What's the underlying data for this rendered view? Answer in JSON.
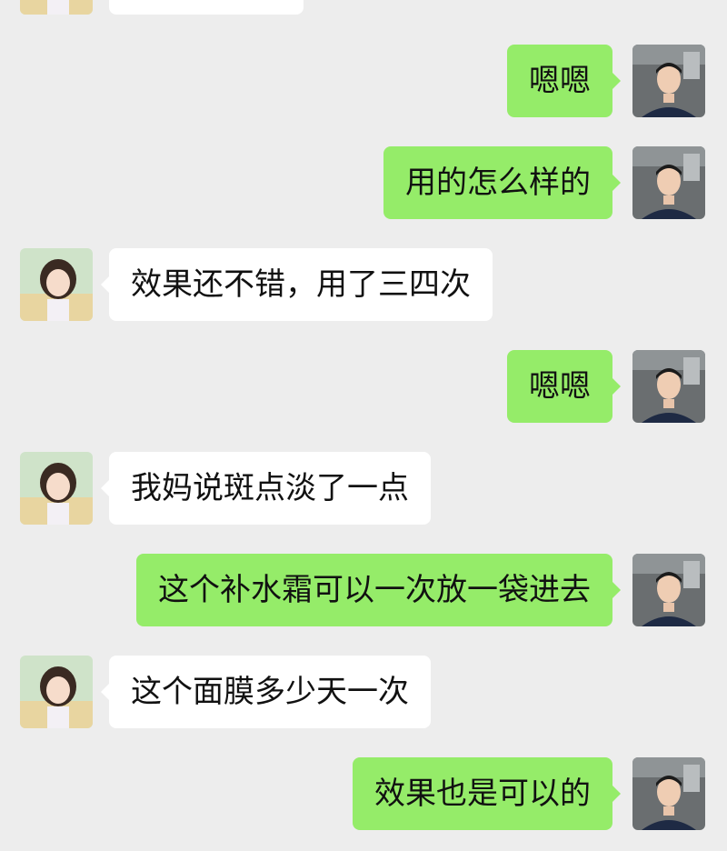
{
  "conversation": {
    "messages": [
      {
        "side": "left",
        "text": "",
        "avatar": "female-contact-avatar"
      },
      {
        "side": "right",
        "text": "嗯嗯",
        "avatar": "male-user-avatar"
      },
      {
        "side": "right",
        "text": "用的怎么样的",
        "avatar": "male-user-avatar"
      },
      {
        "side": "left",
        "text": "效果还不错，用了三四次",
        "avatar": "female-contact-avatar"
      },
      {
        "side": "right",
        "text": "嗯嗯",
        "avatar": "male-user-avatar"
      },
      {
        "side": "left",
        "text": "我妈说斑点淡了一点",
        "avatar": "female-contact-avatar"
      },
      {
        "side": "right",
        "text": "这个补水霜可以一次放一袋进去",
        "avatar": "male-user-avatar"
      },
      {
        "side": "left",
        "text": "这个面膜多少天一次",
        "avatar": "female-contact-avatar"
      },
      {
        "side": "right",
        "text": "效果也是可以的",
        "avatar": "male-user-avatar"
      }
    ]
  },
  "colors": {
    "background": "#ededed",
    "outgoing_bubble": "#95ec69",
    "incoming_bubble": "#ffffff"
  }
}
